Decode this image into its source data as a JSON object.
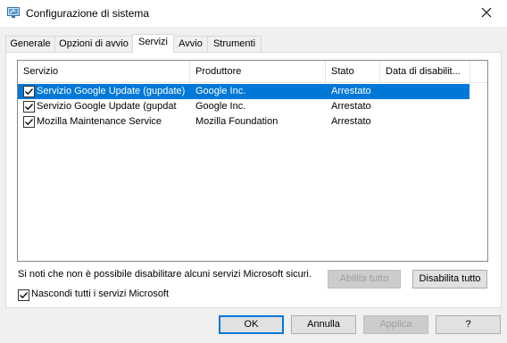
{
  "window": {
    "title": "Configurazione di sistema",
    "icon": "system-config-icon"
  },
  "tabs": [
    {
      "label": "Generale",
      "active": false
    },
    {
      "label": "Opzioni di avvio",
      "active": false
    },
    {
      "label": "Servizi",
      "active": true
    },
    {
      "label": "Avvio",
      "active": false
    },
    {
      "label": "Strumenti",
      "active": false
    }
  ],
  "services": {
    "columns": [
      "Servizio",
      "Produttore",
      "Stato",
      "Data di disabilit..."
    ],
    "rows": [
      {
        "checked": true,
        "name": "Servizio Google Update (gupdate)",
        "manufacturer": "Google Inc.",
        "status": "Arrestato",
        "disabled_date": "",
        "selected": true
      },
      {
        "checked": true,
        "name": "Servizio Google Update (gupdat",
        "manufacturer": "Google Inc.",
        "status": "Arrestato",
        "disabled_date": "",
        "selected": false
      },
      {
        "checked": true,
        "name": "Mozilla Maintenance Service",
        "manufacturer": "Mozilla Foundation",
        "status": "Arrestato",
        "disabled_date": "",
        "selected": false
      }
    ],
    "note": "Si noti che non è possibile disabilitare alcuni servizi Microsoft sicuri.",
    "enable_all_label": "Abilita tutto",
    "disable_all_label": "Disabilita tutto",
    "hide_ms_label": "Nascondi tutti i servizi Microsoft",
    "hide_ms_checked": true
  },
  "footer": {
    "ok_label": "OK",
    "cancel_label": "Annulla",
    "apply_label": "Applica",
    "help_label": "?"
  },
  "colors": {
    "selection": "#0078d7",
    "default_button_border": "#0078d7"
  }
}
